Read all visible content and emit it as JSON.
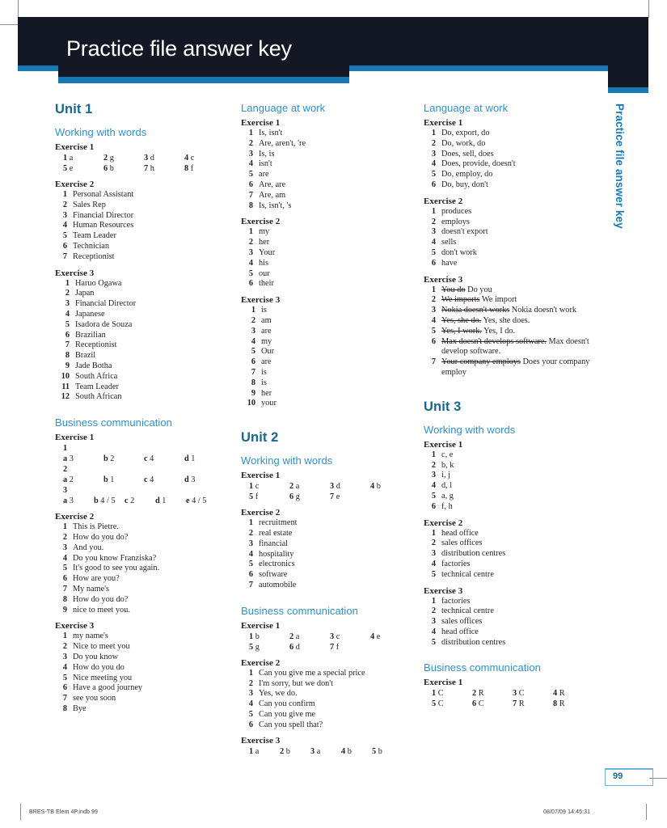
{
  "header": {
    "title": "Practice file answer key",
    "side_tab": "Practice file answer key",
    "band_color": "#141824",
    "accent_color": "#1878b4"
  },
  "page": {
    "number": "99",
    "footer_left": "BRES-TB Elem 4P.indb   99",
    "footer_right": "08/07/09   14:45:31"
  },
  "columns": [
    {
      "id": "col1",
      "blocks": [
        {
          "type": "unit",
          "label": "Unit 1"
        },
        {
          "type": "section",
          "label": "Working with words"
        },
        {
          "type": "exercise",
          "label": "Exercise 1"
        },
        {
          "type": "grid",
          "rows": [
            [
              {
                "n": "1",
                "v": "a"
              },
              {
                "n": "2",
                "v": "g"
              },
              {
                "n": "3",
                "v": "d"
              },
              {
                "n": "4",
                "v": "c"
              }
            ],
            [
              {
                "n": "5",
                "v": "e"
              },
              {
                "n": "6",
                "v": "b"
              },
              {
                "n": "7",
                "v": "h"
              },
              {
                "n": "8",
                "v": "f"
              }
            ]
          ]
        },
        {
          "type": "exercise",
          "label": "Exercise 2"
        },
        {
          "type": "list",
          "items": [
            "Personal Assistant",
            "Sales Rep",
            "Financial Director",
            "Human Resources",
            "Team Leader",
            "Technician",
            "Receptionist"
          ]
        },
        {
          "type": "exercise",
          "label": "Exercise 3"
        },
        {
          "type": "list",
          "wide": true,
          "items": [
            "Haruo Ogawa",
            "Japan",
            "Financial Director",
            "Japanese",
            "Isadora de Souza",
            "Brazilian",
            "Receptionist",
            "Brazil",
            "Jade Botha",
            "South Africa",
            "Team Leader",
            "South African"
          ]
        },
        {
          "type": "section",
          "label": "Business communication",
          "gap": true
        },
        {
          "type": "exercise",
          "label": "Exercise 1"
        },
        {
          "type": "sublabel",
          "label": "1"
        },
        {
          "type": "grid",
          "rows": [
            [
              {
                "n": "a",
                "v": "3"
              },
              {
                "n": "b",
                "v": "2"
              },
              {
                "n": "c",
                "v": "4"
              },
              {
                "n": "d",
                "v": "1"
              }
            ]
          ]
        },
        {
          "type": "sublabel",
          "label": "2"
        },
        {
          "type": "grid",
          "rows": [
            [
              {
                "n": "a",
                "v": "2"
              },
              {
                "n": "b",
                "v": "1"
              },
              {
                "n": "c",
                "v": "4"
              },
              {
                "n": "d",
                "v": "3"
              }
            ]
          ]
        },
        {
          "type": "sublabel",
          "label": "3"
        },
        {
          "type": "grid",
          "narrow": true,
          "rows": [
            [
              {
                "n": "a",
                "v": "3"
              },
              {
                "n": "b",
                "v": "4 / 5"
              },
              {
                "n": "c",
                "v": "2"
              },
              {
                "n": "d",
                "v": "1"
              },
              {
                "n": "e",
                "v": "4 / 5"
              }
            ]
          ]
        },
        {
          "type": "exercise",
          "label": "Exercise 2"
        },
        {
          "type": "list",
          "items": [
            "This is Pietre.",
            "How do you do?",
            "And you.",
            "Do you know Franziska?",
            "It's good to see you again.",
            "How are you?",
            "My name's",
            "How do you do?",
            "nice to meet you."
          ]
        },
        {
          "type": "exercise",
          "label": "Exercise 3"
        },
        {
          "type": "list",
          "items": [
            "my name's",
            "Nice to meet you",
            "Do you know",
            "How do you do",
            "Nice meeting you",
            "Have a good journey",
            "see you soon",
            "Bye"
          ]
        }
      ]
    },
    {
      "id": "col2",
      "blocks": [
        {
          "type": "section",
          "label": "Language at work"
        },
        {
          "type": "exercise",
          "label": "Exercise 1"
        },
        {
          "type": "list",
          "items": [
            "Is, isn't",
            "Are, aren't, 're",
            "Is, is",
            "isn't",
            "are",
            "Are, are",
            "Are, am",
            "Is, isn't, 's"
          ]
        },
        {
          "type": "exercise",
          "label": "Exercise 2"
        },
        {
          "type": "list",
          "items": [
            "my",
            "her",
            "Your",
            "his",
            "our",
            "their"
          ]
        },
        {
          "type": "exercise",
          "label": "Exercise 3"
        },
        {
          "type": "list",
          "wide": true,
          "items": [
            "is",
            "am",
            "are",
            "my",
            "Our",
            "are",
            "is",
            "is",
            "her",
            "your"
          ]
        },
        {
          "type": "unit",
          "label": "Unit 2",
          "spaced": true
        },
        {
          "type": "section",
          "label": "Working with words"
        },
        {
          "type": "exercise",
          "label": "Exercise 1"
        },
        {
          "type": "grid",
          "rows": [
            [
              {
                "n": "1",
                "v": "c"
              },
              {
                "n": "2",
                "v": "a"
              },
              {
                "n": "3",
                "v": "d"
              },
              {
                "n": "4",
                "v": "b"
              }
            ],
            [
              {
                "n": "5",
                "v": "f"
              },
              {
                "n": "6",
                "v": "g"
              },
              {
                "n": "7",
                "v": "e"
              }
            ]
          ]
        },
        {
          "type": "exercise",
          "label": "Exercise 2"
        },
        {
          "type": "list",
          "items": [
            "recruitment",
            "real estate",
            "financial",
            "hospitality",
            "electronics",
            "software",
            "automobile"
          ]
        },
        {
          "type": "section",
          "label": "Business communication",
          "gap": true
        },
        {
          "type": "exercise",
          "label": "Exercise 1"
        },
        {
          "type": "grid",
          "rows": [
            [
              {
                "n": "1",
                "v": "b"
              },
              {
                "n": "2",
                "v": "a"
              },
              {
                "n": "3",
                "v": "c"
              },
              {
                "n": "4",
                "v": "e"
              }
            ],
            [
              {
                "n": "5",
                "v": "g"
              },
              {
                "n": "6",
                "v": "d"
              },
              {
                "n": "7",
                "v": "f"
              }
            ]
          ]
        },
        {
          "type": "exercise",
          "label": "Exercise 2"
        },
        {
          "type": "list",
          "items": [
            "Can you give me a special price",
            "I'm sorry, but we don't",
            "Yes, we do.",
            "Can you confirm",
            "Can you give me",
            "Can you spell that?"
          ]
        },
        {
          "type": "exercise",
          "label": "Exercise 3"
        },
        {
          "type": "grid",
          "narrow": true,
          "rows": [
            [
              {
                "n": "1",
                "v": "a"
              },
              {
                "n": "2",
                "v": "b"
              },
              {
                "n": "3",
                "v": "a"
              },
              {
                "n": "4",
                "v": "b"
              },
              {
                "n": "5",
                "v": "b"
              }
            ]
          ]
        }
      ]
    },
    {
      "id": "col3",
      "blocks": [
        {
          "type": "section",
          "label": "Language at work"
        },
        {
          "type": "exercise",
          "label": "Exercise 1"
        },
        {
          "type": "list",
          "items": [
            "Do, export, do",
            "Do, work, do",
            "Does, sell, does",
            "Does, provide, doesn't",
            "Do, employ, do",
            "Do, buy, don't"
          ]
        },
        {
          "type": "exercise",
          "label": "Exercise 2"
        },
        {
          "type": "list",
          "items": [
            "produces",
            "employs",
            "doesn't export",
            "sells",
            "don't work",
            "have"
          ]
        },
        {
          "type": "exercise",
          "label": "Exercise 3"
        },
        {
          "type": "corrections",
          "items": [
            {
              "wrong": "You do",
              "right": "Do you"
            },
            {
              "wrong": "We imports",
              "right": "We import"
            },
            {
              "wrong": "Nokia doesn't works",
              "right": "Nokia doesn't work"
            },
            {
              "wrong": "Yes, she do.",
              "right": "Yes, she does."
            },
            {
              "wrong": "Yes, I work.",
              "right": "Yes, I do."
            },
            {
              "wrong": "Max doesn't develops software.",
              "right": "Max doesn't develop software."
            },
            {
              "wrong": "Your company employs",
              "right": "Does your company employ"
            }
          ]
        },
        {
          "type": "unit",
          "label": "Unit 3",
          "spaced": true
        },
        {
          "type": "section",
          "label": "Working with words"
        },
        {
          "type": "exercise",
          "label": "Exercise 1"
        },
        {
          "type": "list",
          "items": [
            "c, e",
            "b, k",
            "i, j",
            "d, l",
            "a, g",
            "f, h"
          ]
        },
        {
          "type": "exercise",
          "label": "Exercise 2"
        },
        {
          "type": "list",
          "items": [
            "head office",
            "sales offices",
            "distribution centres",
            "factories",
            "technical centre"
          ]
        },
        {
          "type": "exercise",
          "label": "Exercise 3"
        },
        {
          "type": "list",
          "items": [
            "factories",
            "technical centre",
            "sales offices",
            "head office",
            "distribution centres"
          ]
        },
        {
          "type": "section",
          "label": "Business communication",
          "gap": true
        },
        {
          "type": "exercise",
          "label": "Exercise 1"
        },
        {
          "type": "grid",
          "rows": [
            [
              {
                "n": "1",
                "v": "C"
              },
              {
                "n": "2",
                "v": "R"
              },
              {
                "n": "3",
                "v": "C"
              },
              {
                "n": "4",
                "v": "R"
              }
            ],
            [
              {
                "n": "5",
                "v": "C"
              },
              {
                "n": "6",
                "v": "C"
              },
              {
                "n": "7",
                "v": "R"
              },
              {
                "n": "8",
                "v": "R"
              }
            ]
          ]
        }
      ]
    }
  ]
}
